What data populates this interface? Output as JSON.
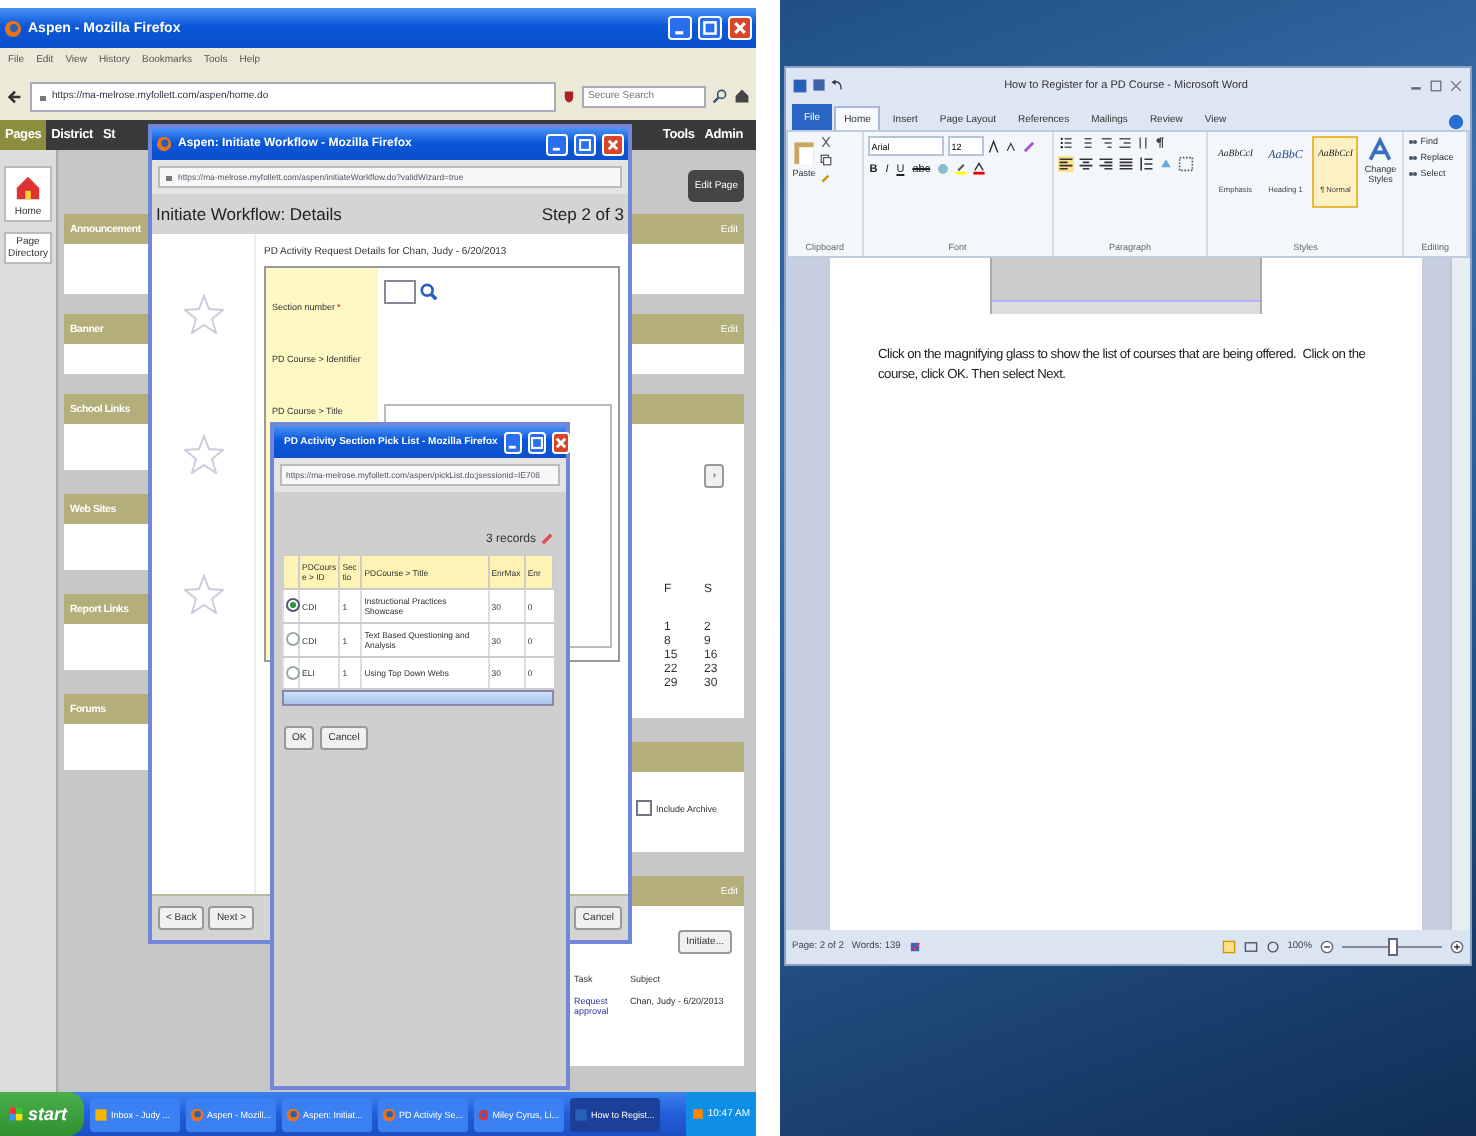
{
  "firefox": {
    "title": "Aspen - Mozilla Firefox",
    "menu": [
      "File",
      "Edit",
      "View",
      "History",
      "Bookmarks",
      "Tools",
      "Help"
    ],
    "url": "https://ma-melrose.myfollett.com/aspen/home.do",
    "search_placeholder": "Secure Search",
    "nav_left": [
      {
        "label": "Pages",
        "selected": true
      },
      {
        "label": "District",
        "selected": false
      },
      {
        "label": "St",
        "selected": false
      }
    ],
    "nav_right": [
      {
        "label": "Tools",
        "selected": false
      },
      {
        "label": "Admin",
        "selected": false
      }
    ],
    "sidebar": {
      "home": "Home",
      "page_directory": "Page Directory"
    },
    "edit_page": "Edit Page",
    "full_widgets": [
      {
        "title": "Announcement",
        "edit": "Edit"
      },
      {
        "title": "Banner",
        "edit": "Edit"
      }
    ],
    "left_widgets": [
      "School Links",
      "Web Sites",
      "Report Links",
      "Forums"
    ],
    "calendar": {
      "next": "›",
      "days": [
        "F",
        "S"
      ],
      "weeks": [
        [
          "1",
          "2"
        ],
        [
          "8",
          "9"
        ],
        [
          "15",
          "16"
        ],
        [
          "22",
          "23"
        ],
        [
          "29",
          "30"
        ]
      ]
    },
    "include_archive": {
      "label": "Include Archive",
      "checked": false
    },
    "workflow_widget": {
      "edit": "Edit",
      "initiate": "Initiate...",
      "columns": [
        "Task",
        "Subject"
      ],
      "rows": [
        [
          "Request approval",
          "Chan, Judy - 6/20/2013"
        ]
      ]
    }
  },
  "workflow_popup": {
    "title": "Aspen: Initiate Workflow - Mozilla Firefox",
    "url": "https://ma-melrose.myfollett.com/aspen/initiateWorkflow.do?validWizard=true",
    "heading": "Initiate Workflow: Details",
    "step": "Step 2 of 3",
    "subheading": "PD Activity Request Details for Chan, Judy - 6/20/2013",
    "fields": [
      {
        "label": "Section number",
        "required": true,
        "kind": "lookup"
      },
      {
        "label": "PD Course > Identifier",
        "required": false,
        "kind": "text"
      },
      {
        "label": "PD Course > Title",
        "required": false,
        "kind": "text"
      }
    ],
    "required_mark": "*",
    "back": "< Back",
    "next": "Next >",
    "cancel": "Cancel"
  },
  "picklist_popup": {
    "title": "PD Activity Section Pick List - Mozilla Firefox",
    "url": "https://ma-melrose.myfollett.com/aspen/pickList.do;jsessionid=IE708",
    "records": "3 records",
    "columns": [
      "PDCourse > ID",
      "Sectio",
      "PDCourse > Title",
      "EnrMax",
      "Enr"
    ],
    "rows": [
      {
        "cells": [
          "CDI",
          "1",
          "Instructional Practices Showcase",
          "30",
          "0"
        ],
        "selected": true
      },
      {
        "cells": [
          "CDI",
          "1",
          "Text Based Questioning and Analysis",
          "30",
          "0"
        ],
        "selected": false
      },
      {
        "cells": [
          "ELI",
          "1",
          "Using Top Down Webs",
          "30",
          "0"
        ],
        "selected": false
      }
    ],
    "ok": "OK",
    "cancel": "Cancel"
  },
  "taskbar": {
    "start": "start",
    "tasks": [
      {
        "label": "Inbox - Judy ...",
        "kind": "mail",
        "selected": false
      },
      {
        "label": "Aspen - Mozill...",
        "kind": "firefox",
        "selected": false
      },
      {
        "label": "Aspen: Initiat...",
        "kind": "firefox",
        "selected": false
      },
      {
        "label": "PD Activity Se...",
        "kind": "firefox",
        "selected": false
      },
      {
        "label": "Miley Cyrus, Li...",
        "kind": "chrome",
        "selected": false
      },
      {
        "label": "How to Regist...",
        "kind": "word",
        "selected": true
      }
    ],
    "clock": "10:47 AM"
  },
  "word": {
    "title": "How to Register for a PD Course - Microsoft Word",
    "file_tab": "File",
    "tabs": [
      {
        "label": "Home",
        "selected": true
      },
      {
        "label": "Insert",
        "selected": false
      },
      {
        "label": "Page Layout",
        "selected": false
      },
      {
        "label": "References",
        "selected": false
      },
      {
        "label": "Mailings",
        "selected": false
      },
      {
        "label": "Review",
        "selected": false
      },
      {
        "label": "View",
        "selected": false
      }
    ],
    "clipboard": {
      "paste": "Paste",
      "group": "Clipboard"
    },
    "font": {
      "name": "Arial",
      "size": "12",
      "buttons": [
        "B",
        "I",
        "U",
        "abc"
      ],
      "group": "Font"
    },
    "paragraph": {
      "group": "Paragraph"
    },
    "styles": {
      "items": [
        {
          "sample": "AaBbCcI",
          "name": "Emphasis",
          "selected": false
        },
        {
          "sample": "AaBbC",
          "name": "Heading 1",
          "selected": false
        },
        {
          "sample": "AaBbCcI",
          "name": "¶ Normal",
          "selected": true
        }
      ],
      "change": "Change Styles",
      "group": "Styles"
    },
    "editing": {
      "items": [
        "Find",
        "Replace",
        "Select"
      ],
      "group": "Editing"
    },
    "document": {
      "text": "Click on the magnifying glass to show the list of courses that are being offered.  Click on the course, click OK. Then select Next."
    },
    "status": {
      "page": "Page: 2 of 2",
      "words": "Words: 139",
      "zoom": "100%",
      "zoom_slider": {
        "level": 0.5
      }
    }
  }
}
